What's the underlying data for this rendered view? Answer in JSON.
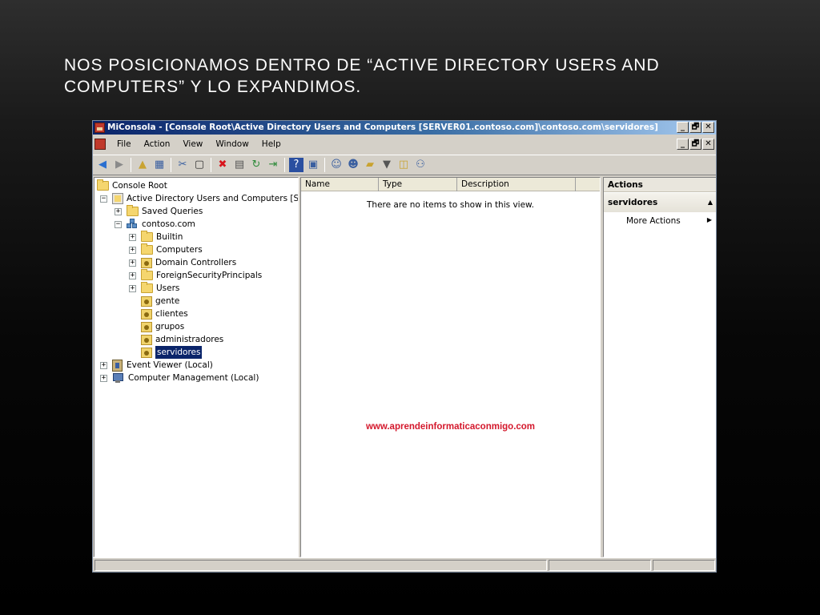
{
  "slide": {
    "title_line1": "NOS POSICIONAMOS DENTRO DE “ACTIVE DIRECTORY USERS AND",
    "title_line2": "COMPUTERS” Y LO EXPANDIMOS."
  },
  "window": {
    "title": "MiConsola - [Console Root\\Active Directory Users and Computers [SERVER01.contoso.com]\\contoso.com\\servidores]",
    "controls": [
      "_",
      "🗗",
      "✕"
    ]
  },
  "menu": {
    "items": [
      "File",
      "Action",
      "View",
      "Window",
      "Help"
    ],
    "child_controls": [
      "_",
      "🗗",
      "✕"
    ]
  },
  "tree": {
    "items": [
      {
        "label": "Console Root",
        "icon": "folder-icon",
        "indent": 0,
        "expander": "none"
      },
      {
        "label": "Active Directory Users and Computers [SERV",
        "icon": "ad-icon",
        "indent": 1,
        "expander": "minus"
      },
      {
        "label": "Saved Queries",
        "icon": "folder-icon",
        "indent": 2,
        "expander": "plus"
      },
      {
        "label": "contoso.com",
        "icon": "domain-icon",
        "indent": 2,
        "expander": "minus"
      },
      {
        "label": "Builtin",
        "icon": "folder-icon",
        "indent": 3,
        "expander": "plus"
      },
      {
        "label": "Computers",
        "icon": "folder-icon",
        "indent": 3,
        "expander": "plus"
      },
      {
        "label": "Domain Controllers",
        "icon": "ou-icon",
        "indent": 3,
        "expander": "plus"
      },
      {
        "label": "ForeignSecurityPrincipals",
        "icon": "folder-icon",
        "indent": 3,
        "expander": "plus"
      },
      {
        "label": "Users",
        "icon": "folder-icon",
        "indent": 3,
        "expander": "plus"
      },
      {
        "label": "gente",
        "icon": "ou-icon",
        "indent": 3,
        "expander": "none"
      },
      {
        "label": "clientes",
        "icon": "ou-icon",
        "indent": 3,
        "expander": "none"
      },
      {
        "label": "grupos",
        "icon": "ou-icon",
        "indent": 3,
        "expander": "none"
      },
      {
        "label": "administradores",
        "icon": "ou-icon",
        "indent": 3,
        "expander": "none"
      },
      {
        "label": "servidores",
        "icon": "ou-icon",
        "indent": 3,
        "expander": "none",
        "selected": true
      },
      {
        "label": "Event Viewer (Local)",
        "icon": "event-viewer-icon",
        "indent": 1,
        "expander": "plus"
      },
      {
        "label": "Computer Management (Local)",
        "icon": "computer-management-icon",
        "indent": 1,
        "expander": "plus"
      }
    ]
  },
  "list": {
    "columns": [
      "Name",
      "Type",
      "Description"
    ],
    "empty_message": "There are no items to show in this view.",
    "watermark": "www.aprendeinformaticaconmigo.com"
  },
  "actions": {
    "header": "Actions",
    "section": "servidores",
    "items": [
      "More Actions"
    ]
  },
  "colors": {
    "selection": "#0a246a",
    "watermark": "#d4182c",
    "titlebar_start": "#0a246a",
    "titlebar_end": "#a6caf0"
  },
  "toolbar": {
    "icons": [
      "back-arrow-icon",
      "forward-arrow-icon",
      "up-folder-icon",
      "show-hide-tree-icon",
      "cut-icon",
      "copy-icon",
      "delete-icon",
      "properties-icon",
      "refresh-icon",
      "export-list-icon",
      "help-icon",
      "show-hide-action-pane-icon",
      "new-user-icon",
      "new-group-icon",
      "new-ou-icon",
      "filter-icon",
      "find-icon",
      "add-to-group-icon"
    ]
  }
}
